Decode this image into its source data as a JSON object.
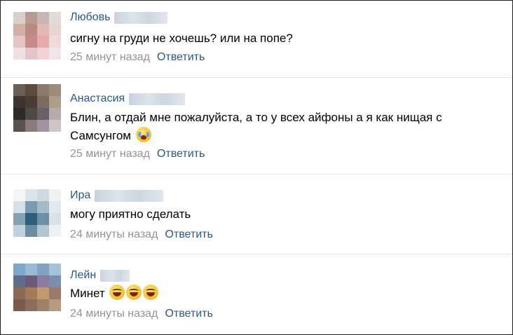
{
  "comments": [
    {
      "name": "Любовь",
      "text": "сигну на груди не хочешь? или на попе?",
      "time": "25 минут назад",
      "reply": "Ответить",
      "emoji": []
    },
    {
      "name": "Анастасия",
      "text": "Блин, а отдай мне пожалуйста, а то у всех айфоны а я как нищая с Самсунгом",
      "time": "25 минут назад",
      "reply": "Ответить",
      "emoji": [
        "crying-face-icon"
      ]
    },
    {
      "name": "Ира",
      "text": "могу приятно сделать",
      "time": "24 минуты назад",
      "reply": "Ответить",
      "emoji": []
    },
    {
      "name": "Лейн",
      "text": "Минет",
      "time": "24 минуты назад",
      "reply": "Ответить",
      "emoji": [
        "laughing-face-icon",
        "laughing-face-icon",
        "laughing-face-icon"
      ]
    }
  ],
  "colors": {
    "name": "#2a5885",
    "meta": "#939393",
    "reply": "#2a5885",
    "divider": "#e4e6ea",
    "text": "#000000"
  }
}
